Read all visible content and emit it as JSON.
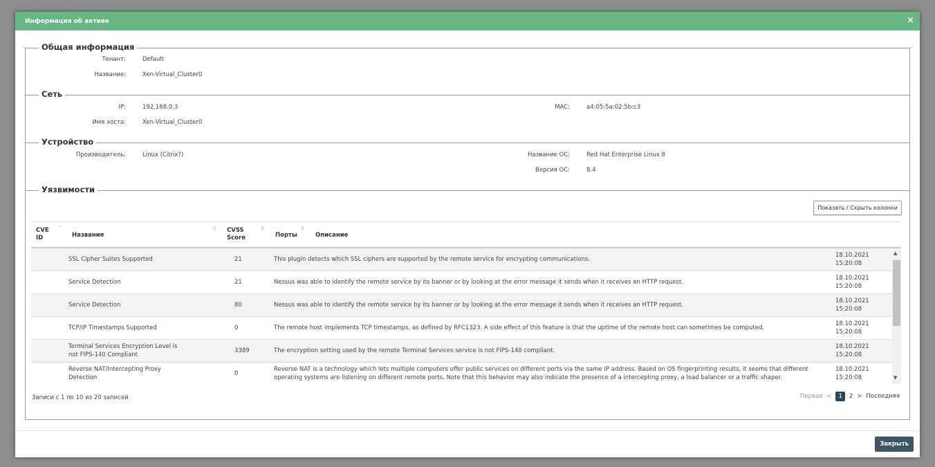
{
  "dialog": {
    "title": "Информация об активе",
    "close_icon": "×",
    "close_button": "Закрыть"
  },
  "general": {
    "title": "Общая информация",
    "tenant_label": "Тенант:",
    "tenant_value": "Default",
    "name_label": "Название:",
    "name_value": "Xen-Virtual_Cluster0"
  },
  "network": {
    "title": "Сеть",
    "ip_label": "IP:",
    "ip_value": "192.168.0.3",
    "mac_label": "MAC:",
    "mac_value": "a4:05:5a:02:5b:c3",
    "host_label": "Имя хоста:",
    "host_value": "Xen-Virtual_Cluster0"
  },
  "device": {
    "title": "Устройство",
    "vendor_label": "Производитель:",
    "vendor_value": "Linux (Citrix?)",
    "os_label": "Название ОС:",
    "os_value": "Red Hat Enterprise Linux 8",
    "osver_label": "Версия ОС:",
    "osver_value": "8.4"
  },
  "vulns": {
    "title": "Уязвимости",
    "toggle_columns": "Показать / Скрыть колонки",
    "headers": {
      "cve_1": "CVE",
      "cve_2": "ID",
      "name": "Название",
      "cvss_1": "CVSS",
      "cvss_2": "Score",
      "ports": "Порты",
      "desc": "Описание"
    },
    "rows": [
      {
        "name_1": "SSL Cipher Suites Supported",
        "name_2": "",
        "port": "21",
        "desc_1": "This plugin detects which SSL ciphers are supported by the remote service for encrypting communications.",
        "desc_2": "",
        "date": "18.10.2021",
        "time": "15:20:08"
      },
      {
        "name_1": "Service Detection",
        "name_2": "",
        "port": "21",
        "desc_1": "Nessus was able to identify the remote service by its banner or by looking at the error message it sends when it receives an HTTP request.",
        "desc_2": "",
        "date": "18.10.2021",
        "time": "15:20:08"
      },
      {
        "name_1": "Service Detection",
        "name_2": "",
        "port": "80",
        "desc_1": "Nessus was able to identify the remote service by its banner or by looking at the error message it sends when it receives an HTTP request.",
        "desc_2": "",
        "date": "18.10.2021",
        "time": "15:20:08"
      },
      {
        "name_1": "TCP/IP Timestamps Supported",
        "name_2": "",
        "port": "0",
        "desc_1": "The remote host implements TCP timestamps, as defined by RFC1323. A side effect of this feature is that the uptime of the remote host can sometimes be computed.",
        "desc_2": "",
        "date": "18.10.2021",
        "time": "15:20:08"
      },
      {
        "name_1": "Terminal Services Encryption Level is",
        "name_2": "not FIPS-140 Compliant",
        "port": "3389",
        "desc_1": "The encryption setting used by the remote Terminal Services service is not FIPS-140 compliant.",
        "desc_2": "",
        "date": "18.10.2021",
        "time": "15:20:08"
      },
      {
        "name_1": "Reverse NAT/Intercepting Proxy",
        "name_2": "Detection",
        "port": "0",
        "desc_1": "Reverse NAT is a technology which lets multiple computers offer public services on different ports via the same IP address. Based on OS fingerprinting results, it seems that different",
        "desc_2": "operating systems are listening on different remote ports. Note that this behavior may also indicate the presence of a intercepting proxy, a load balancer or a traffic shaper.",
        "date": "18.10.2021",
        "time": "15:20:08"
      }
    ],
    "records_info": "Записи с 1 по 10 из 20 записей",
    "pager": {
      "first": "Первая",
      "prev": "<",
      "pages": [
        "1",
        "2"
      ],
      "next": ">",
      "last": "Последняя"
    }
  },
  "colors": {
    "header_bg": "#67b784",
    "close_btn_bg": "#3d5665",
    "active_page_bg": "#2f4858"
  }
}
